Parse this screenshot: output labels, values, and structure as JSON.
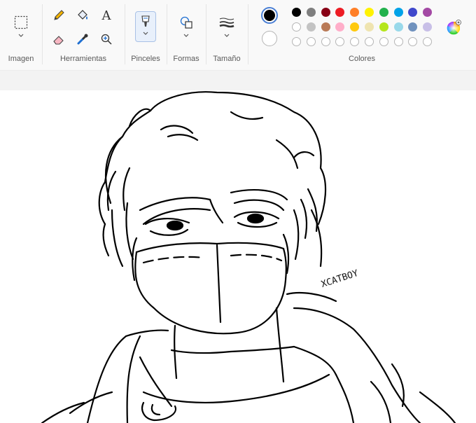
{
  "toolbar": {
    "groups": {
      "image": "Imagen",
      "tools": "Herramientas",
      "brushes": "Pinceles",
      "shapes": "Formas",
      "size": "Tamaño",
      "colors": "Colores"
    },
    "tools": [
      {
        "name": "pencil",
        "icon": "pencil-icon"
      },
      {
        "name": "fill",
        "icon": "fill-bucket-icon"
      },
      {
        "name": "text",
        "icon": "text-icon",
        "glyph": "A"
      },
      {
        "name": "eraser",
        "icon": "eraser-icon"
      },
      {
        "name": "color-picker",
        "icon": "eyedropper-icon"
      },
      {
        "name": "magnifier",
        "icon": "magnifier-icon"
      }
    ],
    "active_colors": {
      "primary": "#000000",
      "secondary": "#ffffff"
    },
    "palette_row1": [
      "#000000",
      "#7f7f7f",
      "#880015",
      "#ed1c24",
      "#ff7f27",
      "#fff200",
      "#22b14c",
      "#00a2e8",
      "#3f48cc",
      "#a349a4"
    ],
    "palette_row2": [
      "#ffffff",
      "#c3c3c3",
      "#b97a57",
      "#ffaec9",
      "#ffc90e",
      "#efe4b0",
      "#b5e61d",
      "#99d9ea",
      "#7092be",
      "#c8bfe7"
    ]
  },
  "canvas": {
    "signature": "XCATBOY"
  }
}
